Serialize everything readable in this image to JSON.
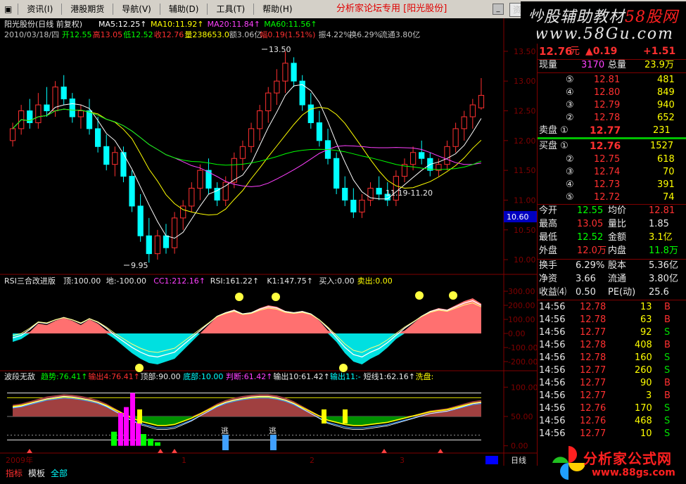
{
  "menu": {
    "items": [
      "资讯(I)",
      "港股期货",
      "导航(V)",
      "辅助(D)",
      "工具(T)",
      "帮助(H)"
    ],
    "title": "分析家论坛专用 [阳光股份]",
    "right_label": "资讯"
  },
  "watermark": {
    "line1_a": "炒股辅助教材",
    "line1_b": "58股网",
    "line2": "www.58Gu.com"
  },
  "main_panel": {
    "name": "阳光股份(日线 前复权)",
    "ma": [
      {
        "label": "MA5:12.25↑",
        "color": "#ffffff"
      },
      {
        "label": "MA10:11.92↑",
        "color": "#ffff00"
      },
      {
        "label": "MA20:11.84↑",
        "color": "#ff40ff"
      },
      {
        "label": "MA60:11.56↑",
        "color": "#00ff00"
      }
    ],
    "info_date": "2010/03/18/四",
    "info": [
      {
        "label": "开12.55",
        "color": "#00ff00"
      },
      {
        "label": "高13.05",
        "color": "#ff3030"
      },
      {
        "label": "低12.52",
        "color": "#00ff00"
      },
      {
        "label": "收12.76",
        "color": "#ff3030"
      },
      {
        "label": "量238653.0",
        "color": "#ffff00"
      },
      {
        "label": "额3.06亿",
        "color": "#c0c0c0"
      },
      {
        "label": "幅0.19(1.51%)",
        "color": "#ff3030"
      },
      {
        "label": "振4.22%",
        "color": "#c0c0c0"
      },
      {
        "label": "换6.29%",
        "color": "#c0c0c0"
      },
      {
        "label": "流通3.80亿",
        "color": "#c0c0c0"
      }
    ],
    "high_label": "13.50",
    "low_label": "9.95",
    "range_label": "11.19-11.20",
    "price_ticks": [
      "13.50",
      "13.00",
      "12.50",
      "12.00",
      "11.50",
      "11.00",
      "10.50",
      "10.00"
    ],
    "price_marker": "10.60"
  },
  "rsi_panel": {
    "title": "RSI三合改进版",
    "items": [
      {
        "label": "顶:100.00",
        "color": "#e8e8e8"
      },
      {
        "label": "地:-100.00",
        "color": "#e8e8e8"
      },
      {
        "label": "CC1:212.16↑",
        "color": "#ff40ff"
      },
      {
        "label": "RSI:161.22↑",
        "color": "#e8e8e8"
      },
      {
        "label": "K1:147.75↑",
        "color": "#e8e8e8"
      },
      {
        "label": "买入:0.00",
        "color": "#e8e8e8"
      },
      {
        "label": "卖出:0.00",
        "color": "#ffff00"
      }
    ],
    "ticks": [
      "300.00",
      "200.00",
      "100.00",
      "0.00",
      "-100.00",
      "-200.00"
    ]
  },
  "wave_panel": {
    "title": "波段无敌",
    "items": [
      {
        "label": "趋势:76.41↑",
        "color": "#00ff00"
      },
      {
        "label": "输出4:76.41↑",
        "color": "#ff3030"
      },
      {
        "label": "顶部:90.00",
        "color": "#e8e8e8"
      },
      {
        "label": "底部:10.00",
        "color": "#00ffff"
      },
      {
        "label": "判断:61.42↑",
        "color": "#ff40ff"
      },
      {
        "label": "输出10:61.42↑",
        "color": "#e8e8e8"
      },
      {
        "label": "输出11:-",
        "color": "#00ffff"
      },
      {
        "label": "短线1:62.16↑",
        "color": "#e8e8e8"
      },
      {
        "label": "洗盘:",
        "color": "#ffff00"
      }
    ],
    "ticks": [
      "100.00",
      "50.00",
      "0.00"
    ],
    "escape_label": "逃"
  },
  "xaxis": {
    "labels": [
      "2009年",
      "1",
      "2",
      "3"
    ],
    "period": "日线"
  },
  "quote": {
    "price": "12.76",
    "price_unit": "元",
    "change": "▲0.19",
    "change2": "+1.51",
    "now_vol_label": "现量",
    "now_vol": "3170",
    "total_vol_label": "总量",
    "total_vol": "23.9万",
    "sells": [
      {
        "lvl": "⑤",
        "price": "12.81",
        "vol": "481"
      },
      {
        "lvl": "④",
        "price": "12.80",
        "vol": "849"
      },
      {
        "lvl": "③",
        "price": "12.79",
        "vol": "940"
      },
      {
        "lvl": "②",
        "price": "12.78",
        "vol": "652"
      }
    ],
    "sell1_label": "卖盘 ①",
    "sell1_price": "12.77",
    "sell1_vol": "231",
    "buy1_label": "买盘 ①",
    "buy1_price": "12.76",
    "buy1_vol": "1527",
    "buys": [
      {
        "lvl": "②",
        "price": "12.75",
        "vol": "618"
      },
      {
        "lvl": "③",
        "price": "12.74",
        "vol": "70"
      },
      {
        "lvl": "④",
        "price": "12.73",
        "vol": "391"
      },
      {
        "lvl": "⑤",
        "price": "12.72",
        "vol": "74"
      }
    ],
    "stats": [
      {
        "l1": "今开",
        "v1": "12.55",
        "c1": "#00ff00",
        "l2": "均价",
        "v2": "12.81",
        "c2": "#ff3030"
      },
      {
        "l1": "最高",
        "v1": "13.05",
        "c1": "#ff3030",
        "l2": "量比",
        "v2": "1.85",
        "c2": "#e8e8e8"
      },
      {
        "l1": "最低",
        "v1": "12.52",
        "c1": "#00ff00",
        "l2": "金额",
        "v2": "3.1亿",
        "c2": "#ffff00"
      },
      {
        "l1": "外盘",
        "v1": "12.0万",
        "c1": "#ff3030",
        "l2": "内盘",
        "v2": "11.8万",
        "c2": "#00ff00"
      }
    ],
    "stats2": [
      {
        "l1": "换手",
        "v1": "6.29%",
        "l2": "股本",
        "v2": "5.36亿"
      },
      {
        "l1": "净资",
        "v1": "3.66",
        "l2": "流通",
        "v2": "3.80亿"
      },
      {
        "l1": "收益⑷",
        "v1": "0.50",
        "l2": "PE(动)",
        "v2": "25.6"
      }
    ],
    "ticks": [
      {
        "t": "14:56",
        "p": "12.78",
        "v": "13",
        "s": "B"
      },
      {
        "t": "14:56",
        "p": "12.78",
        "v": "63",
        "s": "B"
      },
      {
        "t": "14:56",
        "p": "12.77",
        "v": "92",
        "s": "S"
      },
      {
        "t": "14:56",
        "p": "12.78",
        "v": "408",
        "s": "B"
      },
      {
        "t": "14:56",
        "p": "12.78",
        "v": "160",
        "s": "S"
      },
      {
        "t": "14:56",
        "p": "12.77",
        "v": "260",
        "s": "S"
      },
      {
        "t": "14:56",
        "p": "12.77",
        "v": "90",
        "s": "B"
      },
      {
        "t": "14:56",
        "p": "12.77",
        "v": "3",
        "s": "B"
      },
      {
        "t": "14:56",
        "p": "12.76",
        "v": "170",
        "s": "S"
      },
      {
        "t": "14:56",
        "p": "12.76",
        "v": "468",
        "s": "S"
      },
      {
        "t": "14:56",
        "p": "12.77",
        "v": "10",
        "s": "S"
      }
    ]
  },
  "bottom": {
    "tabs": [
      "指标",
      "模板",
      "全部"
    ],
    "logo_text": "分析家公式网",
    "logo_url": "www.88gs.com"
  },
  "chart_data": {
    "type": "candlestick",
    "x": [
      "2009-12",
      "2010-01",
      "2010-02",
      "2010-03"
    ],
    "ylim": [
      9.8,
      13.7
    ],
    "candles": [
      [
        12.0,
        12.3,
        11.9,
        12.2
      ],
      [
        12.2,
        12.6,
        12.1,
        12.5
      ],
      [
        12.5,
        12.7,
        12.2,
        12.3
      ],
      [
        12.3,
        12.8,
        12.2,
        12.6
      ],
      [
        12.6,
        12.9,
        12.4,
        12.5
      ],
      [
        12.5,
        13.0,
        12.4,
        12.9
      ],
      [
        12.9,
        13.1,
        12.6,
        12.7
      ],
      [
        12.7,
        12.8,
        12.3,
        12.4
      ],
      [
        12.4,
        12.6,
        12.2,
        12.5
      ],
      [
        12.5,
        12.7,
        12.1,
        12.2
      ],
      [
        12.2,
        12.4,
        11.8,
        11.9
      ],
      [
        11.9,
        12.1,
        11.5,
        11.6
      ],
      [
        11.6,
        11.9,
        11.4,
        11.8
      ],
      [
        11.8,
        11.9,
        11.3,
        11.4
      ],
      [
        11.4,
        11.5,
        10.8,
        10.9
      ],
      [
        10.9,
        11.1,
        10.3,
        10.4
      ],
      [
        10.4,
        10.7,
        9.95,
        10.1
      ],
      [
        10.1,
        10.5,
        10.0,
        10.4
      ],
      [
        10.4,
        10.6,
        10.1,
        10.2
      ],
      [
        10.2,
        10.8,
        10.1,
        10.7
      ],
      [
        10.7,
        11.0,
        10.5,
        10.9
      ],
      [
        10.9,
        11.3,
        10.8,
        11.2
      ],
      [
        11.2,
        11.6,
        11.0,
        11.5
      ],
      [
        11.5,
        11.7,
        11.1,
        11.2
      ],
      [
        11.2,
        11.3,
        10.9,
        11.0
      ],
      [
        11.0,
        11.4,
        10.9,
        11.3
      ],
      [
        11.3,
        11.8,
        11.2,
        11.7
      ],
      [
        11.7,
        12.0,
        11.5,
        11.9
      ],
      [
        11.9,
        12.3,
        11.8,
        12.2
      ],
      [
        12.2,
        12.6,
        12.0,
        12.5
      ],
      [
        12.5,
        12.9,
        12.3,
        12.8
      ],
      [
        12.8,
        13.2,
        12.6,
        13.0
      ],
      [
        13.0,
        13.5,
        12.8,
        13.3
      ],
      [
        13.3,
        13.4,
        12.9,
        13.0
      ],
      [
        13.0,
        13.1,
        12.5,
        12.6
      ],
      [
        12.6,
        12.8,
        12.2,
        12.3
      ],
      [
        12.3,
        12.5,
        11.9,
        12.0
      ],
      [
        12.0,
        12.2,
        11.6,
        11.7
      ],
      [
        11.7,
        11.8,
        11.1,
        11.2
      ],
      [
        11.2,
        11.4,
        10.9,
        11.0
      ],
      [
        11.0,
        11.2,
        10.7,
        10.8
      ],
      [
        10.8,
        11.1,
        10.7,
        11.0
      ],
      [
        11.0,
        11.3,
        10.9,
        11.2
      ],
      [
        11.2,
        11.4,
        11.0,
        11.1
      ],
      [
        11.1,
        11.3,
        10.9,
        11.0
      ],
      [
        11.0,
        11.5,
        10.9,
        11.4
      ],
      [
        11.4,
        11.7,
        11.3,
        11.6
      ],
      [
        11.6,
        11.9,
        11.5,
        11.8
      ],
      [
        11.8,
        12.0,
        11.6,
        11.7
      ],
      [
        11.7,
        11.8,
        11.4,
        11.5
      ],
      [
        11.5,
        11.7,
        11.4,
        11.6
      ],
      [
        11.6,
        12.0,
        11.5,
        11.9
      ],
      [
        11.9,
        12.3,
        11.8,
        12.2
      ],
      [
        12.2,
        12.5,
        12.0,
        12.4
      ],
      [
        12.4,
        12.7,
        12.2,
        12.6
      ],
      [
        12.55,
        13.05,
        12.52,
        12.76
      ]
    ]
  }
}
